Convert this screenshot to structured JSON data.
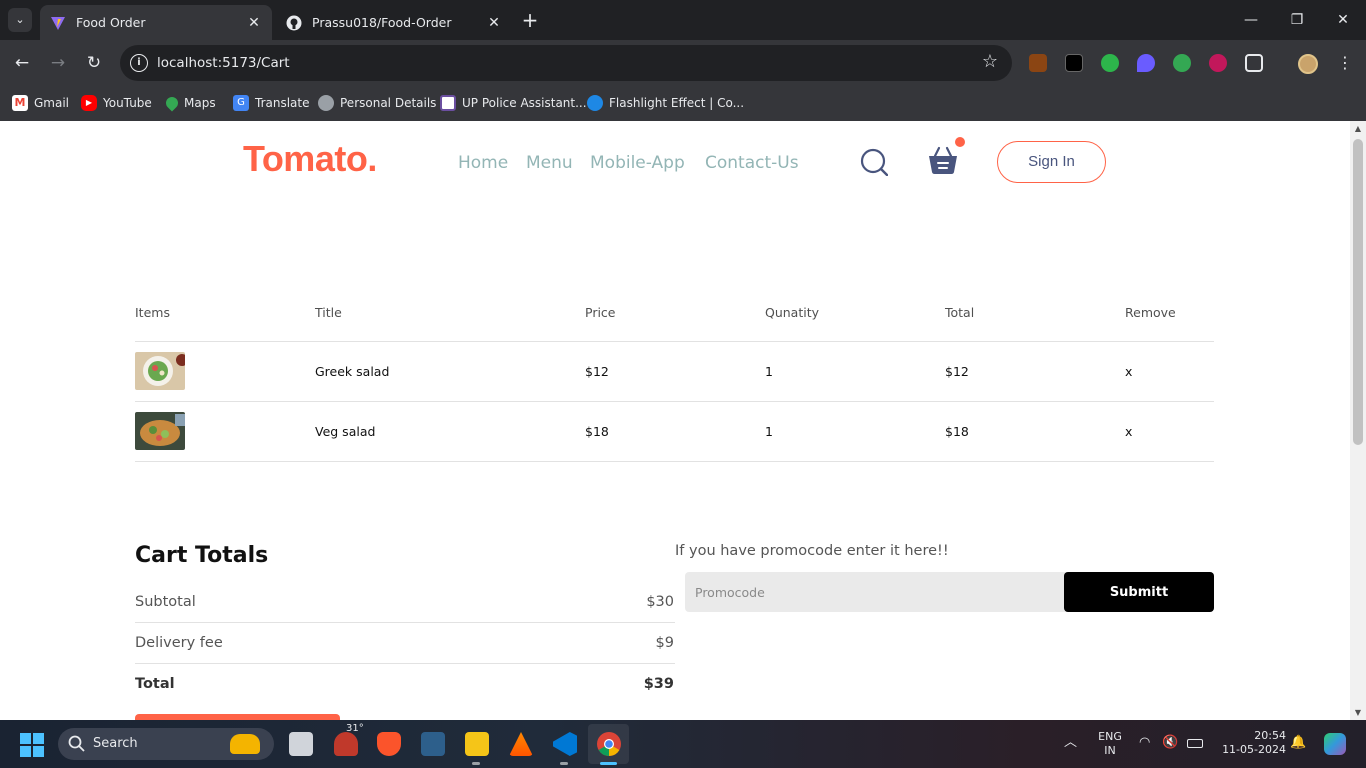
{
  "browser": {
    "tabs": [
      {
        "title": "Food Order",
        "active": true
      },
      {
        "title": "Prassu018/Food-Order",
        "active": false
      }
    ],
    "url": "localhost:5173/Cart",
    "bookmarks": [
      {
        "label": "Gmail",
        "icon": "gmail-icon"
      },
      {
        "label": "YouTube",
        "icon": "youtube-icon"
      },
      {
        "label": "Maps",
        "icon": "maps-icon"
      },
      {
        "label": "Translate",
        "icon": "translate-icon"
      },
      {
        "label": "Personal Details",
        "icon": "globe-icon"
      },
      {
        "label": "UP Police Assistant...",
        "icon": "police-icon"
      },
      {
        "label": "Flashlight Effect | Co...",
        "icon": "flashlight-icon"
      }
    ]
  },
  "site": {
    "logo": "Tomato.",
    "nav": [
      "Home",
      "Menu",
      "Mobile-App",
      "Contact-Us"
    ],
    "sign_in": "Sign In",
    "accent": "#ff6347"
  },
  "cart": {
    "headers": [
      "Items",
      "Title",
      "Price",
      "Qunatity",
      "Total",
      "Remove"
    ],
    "rows": [
      {
        "title": "Greek salad",
        "price": "$12",
        "quantity": "1",
        "total": "$12",
        "remove": "x"
      },
      {
        "title": "Veg salad",
        "price": "$18",
        "quantity": "1",
        "total": "$18",
        "remove": "x"
      }
    ]
  },
  "totals": {
    "title": "Cart Totals",
    "subtotal_label": "Subtotal",
    "subtotal": "$30",
    "delivery_label": "Delivery fee",
    "delivery": "$9",
    "total_label": "Total",
    "total": "$39"
  },
  "promo": {
    "prompt": "If you have promocode enter it here!!",
    "placeholder": "Promocode",
    "submit": "Submitt"
  },
  "taskbar": {
    "search": "Search",
    "weather": "31°",
    "lang_top": "ENG",
    "lang_bottom": "IN",
    "time": "20:54",
    "date": "11-05-2024"
  }
}
